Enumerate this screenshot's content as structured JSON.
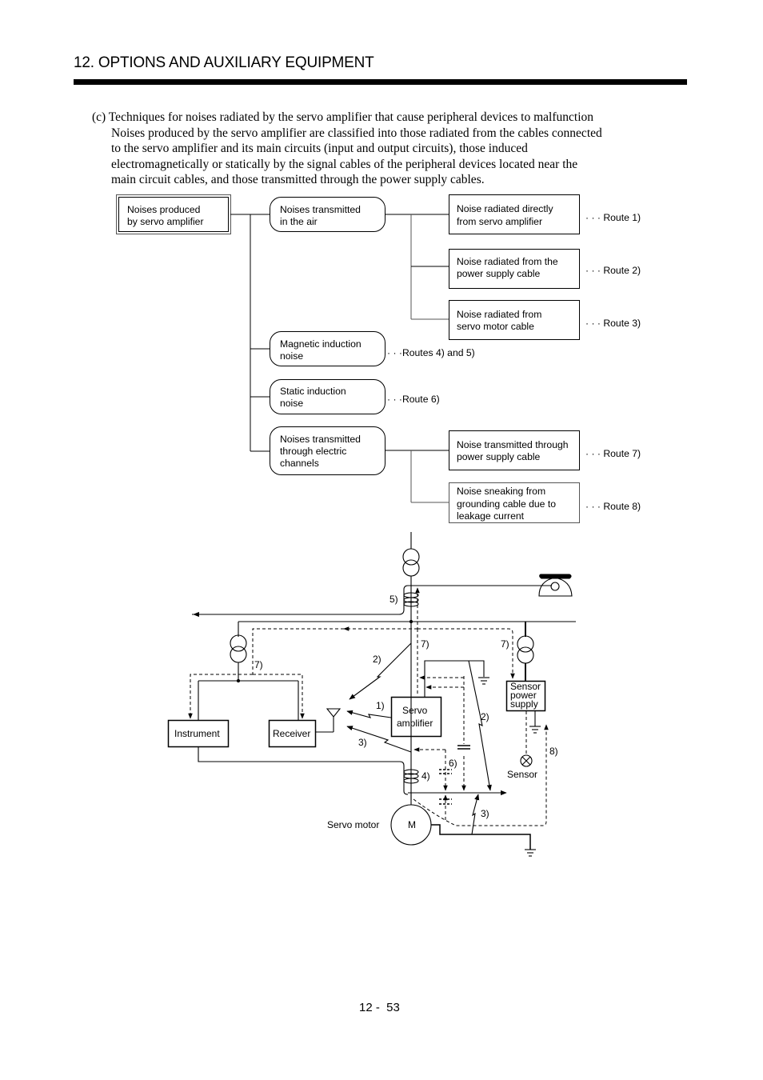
{
  "header": {
    "section_title": "12. OPTIONS AND AUXILIARY EQUIPMENT"
  },
  "paragraph": {
    "lead": "(c) Techniques for noises radiated by the servo amplifier that cause peripheral devices to malfunction",
    "lines": [
      "Noises produced by the servo amplifier are classified into those radiated from the cables connected",
      "to the servo amplifier and its main circuits (input and output circuits), those induced",
      "electromagnetically or statically by the signal cables of the peripheral devices located near the",
      "main circuit cables, and those transmitted through the power supply cables."
    ]
  },
  "tree": {
    "root": [
      "Noises produced",
      "by servo amplifier"
    ],
    "air": [
      "Noises transmitted",
      "in the air"
    ],
    "air_children": [
      {
        "lines": [
          "Noise radiated directly",
          "from servo amplifier"
        ],
        "route": "· · · Route 1)"
      },
      {
        "lines": [
          "Noise radiated from the",
          "power supply cable"
        ],
        "route": "· · · Route 2)"
      },
      {
        "lines": [
          "Noise radiated from",
          "servo motor cable"
        ],
        "route": "· · · Route 3)"
      }
    ],
    "magnetic": {
      "lines": [
        "Magnetic induction",
        "noise"
      ],
      "route": "· · ·Routes 4) and 5)"
    },
    "static": {
      "lines": [
        "Static induction",
        "noise"
      ],
      "route": "· · ·Route 6)"
    },
    "electric": [
      "Noises transmitted",
      "through electric",
      "channels"
    ],
    "electric_children": [
      {
        "lines": [
          "Noise transmitted through",
          "power supply cable"
        ],
        "route": "· · · Route 7)"
      },
      {
        "lines": [
          "Noise sneaking from",
          "grounding cable due to",
          "leakage current"
        ],
        "route": "· · · Route 8)"
      }
    ]
  },
  "diagram": {
    "instrument": "Instrument",
    "receiver": "Receiver",
    "servo_amp": [
      "Servo",
      "amplifier"
    ],
    "sensor_ps": [
      "Sensor",
      "power",
      "supply"
    ],
    "sensor": "Sensor",
    "motor_label": "Servo motor",
    "motor_symbol": "M",
    "routes": {
      "r1": "1)",
      "r2a": "2)",
      "r2b": "2)",
      "r3a": "3)",
      "r3b": "3)",
      "r4": "4)",
      "r5": "5)",
      "r6": "6)",
      "r7a": "7)",
      "r7b": "7)",
      "r7c": "7)",
      "r8": "8)"
    }
  },
  "footer": {
    "page_number": "12 -  53"
  }
}
